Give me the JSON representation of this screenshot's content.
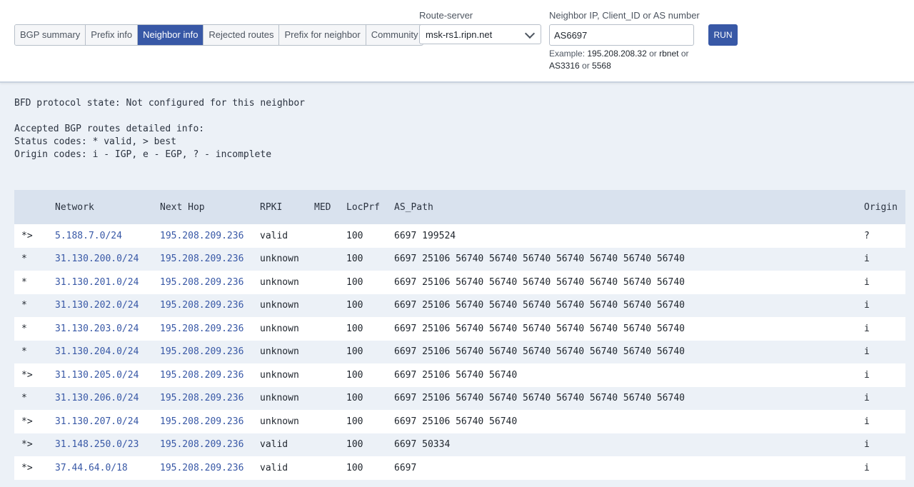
{
  "tabs": [
    {
      "label": "BGP summary",
      "active": false
    },
    {
      "label": "Prefix info",
      "active": false
    },
    {
      "label": "Neighbor info",
      "active": true
    },
    {
      "label": "Rejected routes",
      "active": false
    },
    {
      "label": "Prefix for neighbor",
      "active": false
    },
    {
      "label": "Community",
      "active": false
    }
  ],
  "route_server": {
    "label": "Route-server",
    "value": "msk-rs1.ripn.net"
  },
  "neighbor": {
    "label": "Neighbor IP, Client_ID or AS number",
    "value": "AS6697",
    "hint_prefix": "Example: ",
    "hint_ex1": "195.208.208.32",
    "hint_or1": " or ",
    "hint_ex2": "rbnet",
    "hint_or2": " or ",
    "hint_ex3": "AS3316",
    "hint_or3": " or ",
    "hint_ex4": "5568"
  },
  "run_label": "RUN",
  "output": {
    "bfd_line": "BFD protocol state: Not configured for this neighbor",
    "accepted_line": "Accepted BGP routes detailed info:",
    "status_line": "Status codes: * valid, > best",
    "origin_line": "Origin codes: i - IGP, e - EGP, ? - incomplete"
  },
  "table": {
    "headers": {
      "status": "",
      "network": "Network",
      "next_hop": "Next Hop",
      "rpki": "RPKI",
      "med": "MED",
      "locprf": "LocPrf",
      "as_path": "AS_Path",
      "origin": "Origin"
    },
    "rows": [
      {
        "status": "*>",
        "network": "5.188.7.0/24",
        "next_hop": "195.208.209.236",
        "rpki": "valid",
        "med": "",
        "locprf": "100",
        "as_path": "6697 199524",
        "origin": "?"
      },
      {
        "status": "*",
        "network": "31.130.200.0/24",
        "next_hop": "195.208.209.236",
        "rpki": "unknown",
        "med": "",
        "locprf": "100",
        "as_path": "6697 25106 56740 56740 56740 56740 56740 56740 56740",
        "origin": "i"
      },
      {
        "status": "*",
        "network": "31.130.201.0/24",
        "next_hop": "195.208.209.236",
        "rpki": "unknown",
        "med": "",
        "locprf": "100",
        "as_path": "6697 25106 56740 56740 56740 56740 56740 56740 56740",
        "origin": "i"
      },
      {
        "status": "*",
        "network": "31.130.202.0/24",
        "next_hop": "195.208.209.236",
        "rpki": "unknown",
        "med": "",
        "locprf": "100",
        "as_path": "6697 25106 56740 56740 56740 56740 56740 56740 56740",
        "origin": "i"
      },
      {
        "status": "*",
        "network": "31.130.203.0/24",
        "next_hop": "195.208.209.236",
        "rpki": "unknown",
        "med": "",
        "locprf": "100",
        "as_path": "6697 25106 56740 56740 56740 56740 56740 56740 56740",
        "origin": "i"
      },
      {
        "status": "*",
        "network": "31.130.204.0/24",
        "next_hop": "195.208.209.236",
        "rpki": "unknown",
        "med": "",
        "locprf": "100",
        "as_path": "6697 25106 56740 56740 56740 56740 56740 56740 56740",
        "origin": "i"
      },
      {
        "status": "*>",
        "network": "31.130.205.0/24",
        "next_hop": "195.208.209.236",
        "rpki": "unknown",
        "med": "",
        "locprf": "100",
        "as_path": "6697 25106 56740 56740",
        "origin": "i"
      },
      {
        "status": "*",
        "network": "31.130.206.0/24",
        "next_hop": "195.208.209.236",
        "rpki": "unknown",
        "med": "",
        "locprf": "100",
        "as_path": "6697 25106 56740 56740 56740 56740 56740 56740 56740",
        "origin": "i"
      },
      {
        "status": "*>",
        "network": "31.130.207.0/24",
        "next_hop": "195.208.209.236",
        "rpki": "unknown",
        "med": "",
        "locprf": "100",
        "as_path": "6697 25106 56740 56740",
        "origin": "i"
      },
      {
        "status": "*>",
        "network": "31.148.250.0/23",
        "next_hop": "195.208.209.236",
        "rpki": "valid",
        "med": "",
        "locprf": "100",
        "as_path": "6697 50334",
        "origin": "i"
      },
      {
        "status": "*>",
        "network": "37.44.64.0/18",
        "next_hop": "195.208.209.236",
        "rpki": "valid",
        "med": "",
        "locprf": "100",
        "as_path": "6697",
        "origin": "i"
      }
    ]
  },
  "colors": {
    "accent": "#3858a6",
    "header_row": "#d9e2ee",
    "page_bg": "#ecf1f7"
  }
}
